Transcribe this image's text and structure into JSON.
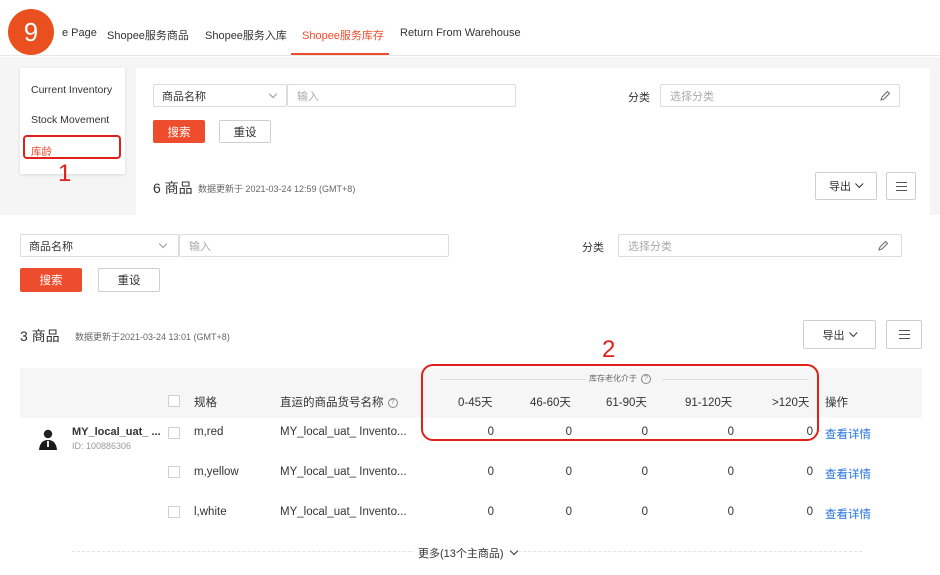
{
  "badge": "9",
  "nav": {
    "tabs": [
      "e Page",
      "Shopee服务商品",
      "Shopee服务入库",
      "Shopee服务库存",
      "Return From Warehouse"
    ],
    "active_index": 3
  },
  "sidebar": {
    "items": [
      "Current Inventory",
      "Stock Movement",
      "库龄"
    ],
    "active_index": 2
  },
  "annotations": {
    "one": "1",
    "two": "2"
  },
  "upper": {
    "product_select": "商品名称",
    "product_input_placeholder": "输入",
    "category_label": "分类",
    "category_placeholder": "选择分类",
    "search_label": "搜索",
    "reset_label": "重设",
    "count": "6 商品",
    "updated": "数据更新于 2021-03-24 12:59 (GMT+8)",
    "export_label": "导出"
  },
  "lower": {
    "product_select": "商品名称",
    "product_input_placeholder": "输入",
    "category_label": "分类",
    "category_placeholder": "选择分类",
    "search_label": "搜索",
    "reset_label": "重设",
    "count": "3 商品",
    "updated": "数据更新于2021-03-24 13:01 (GMT+8)",
    "export_label": "导出"
  },
  "table": {
    "group_header": "库存老化介于",
    "columns": {
      "spec": "规格",
      "sku_name": "直运的商品货号名称",
      "age_0_45": "0-45天",
      "age_46_60": "46-60天",
      "age_61_90": "61-90天",
      "age_91_120": "91-120天",
      "age_120_plus": ">120天",
      "action": "操作"
    },
    "product": {
      "name": "MY_local_uat_ ...",
      "id": "ID: 100886306"
    },
    "rows": [
      {
        "spec": "m,red",
        "sku": "MY_local_uat_ Invento...",
        "a": "0",
        "b": "0",
        "c": "0",
        "d": "0",
        "e": "0",
        "action": "查看详情"
      },
      {
        "spec": "m,yellow",
        "sku": "MY_local_uat_ Invento...",
        "a": "0",
        "b": "0",
        "c": "0",
        "d": "0",
        "e": "0",
        "action": "查看详情"
      },
      {
        "spec": "l,white",
        "sku": "MY_local_uat_ Invento...",
        "a": "0",
        "b": "0",
        "c": "0",
        "d": "0",
        "e": "0",
        "action": "查看详情"
      }
    ],
    "more": "更多(13个主商品)"
  },
  "colors": {
    "accent": "#ee4d2d",
    "annotation_red": "#e0201b",
    "link": "#2673dd"
  }
}
